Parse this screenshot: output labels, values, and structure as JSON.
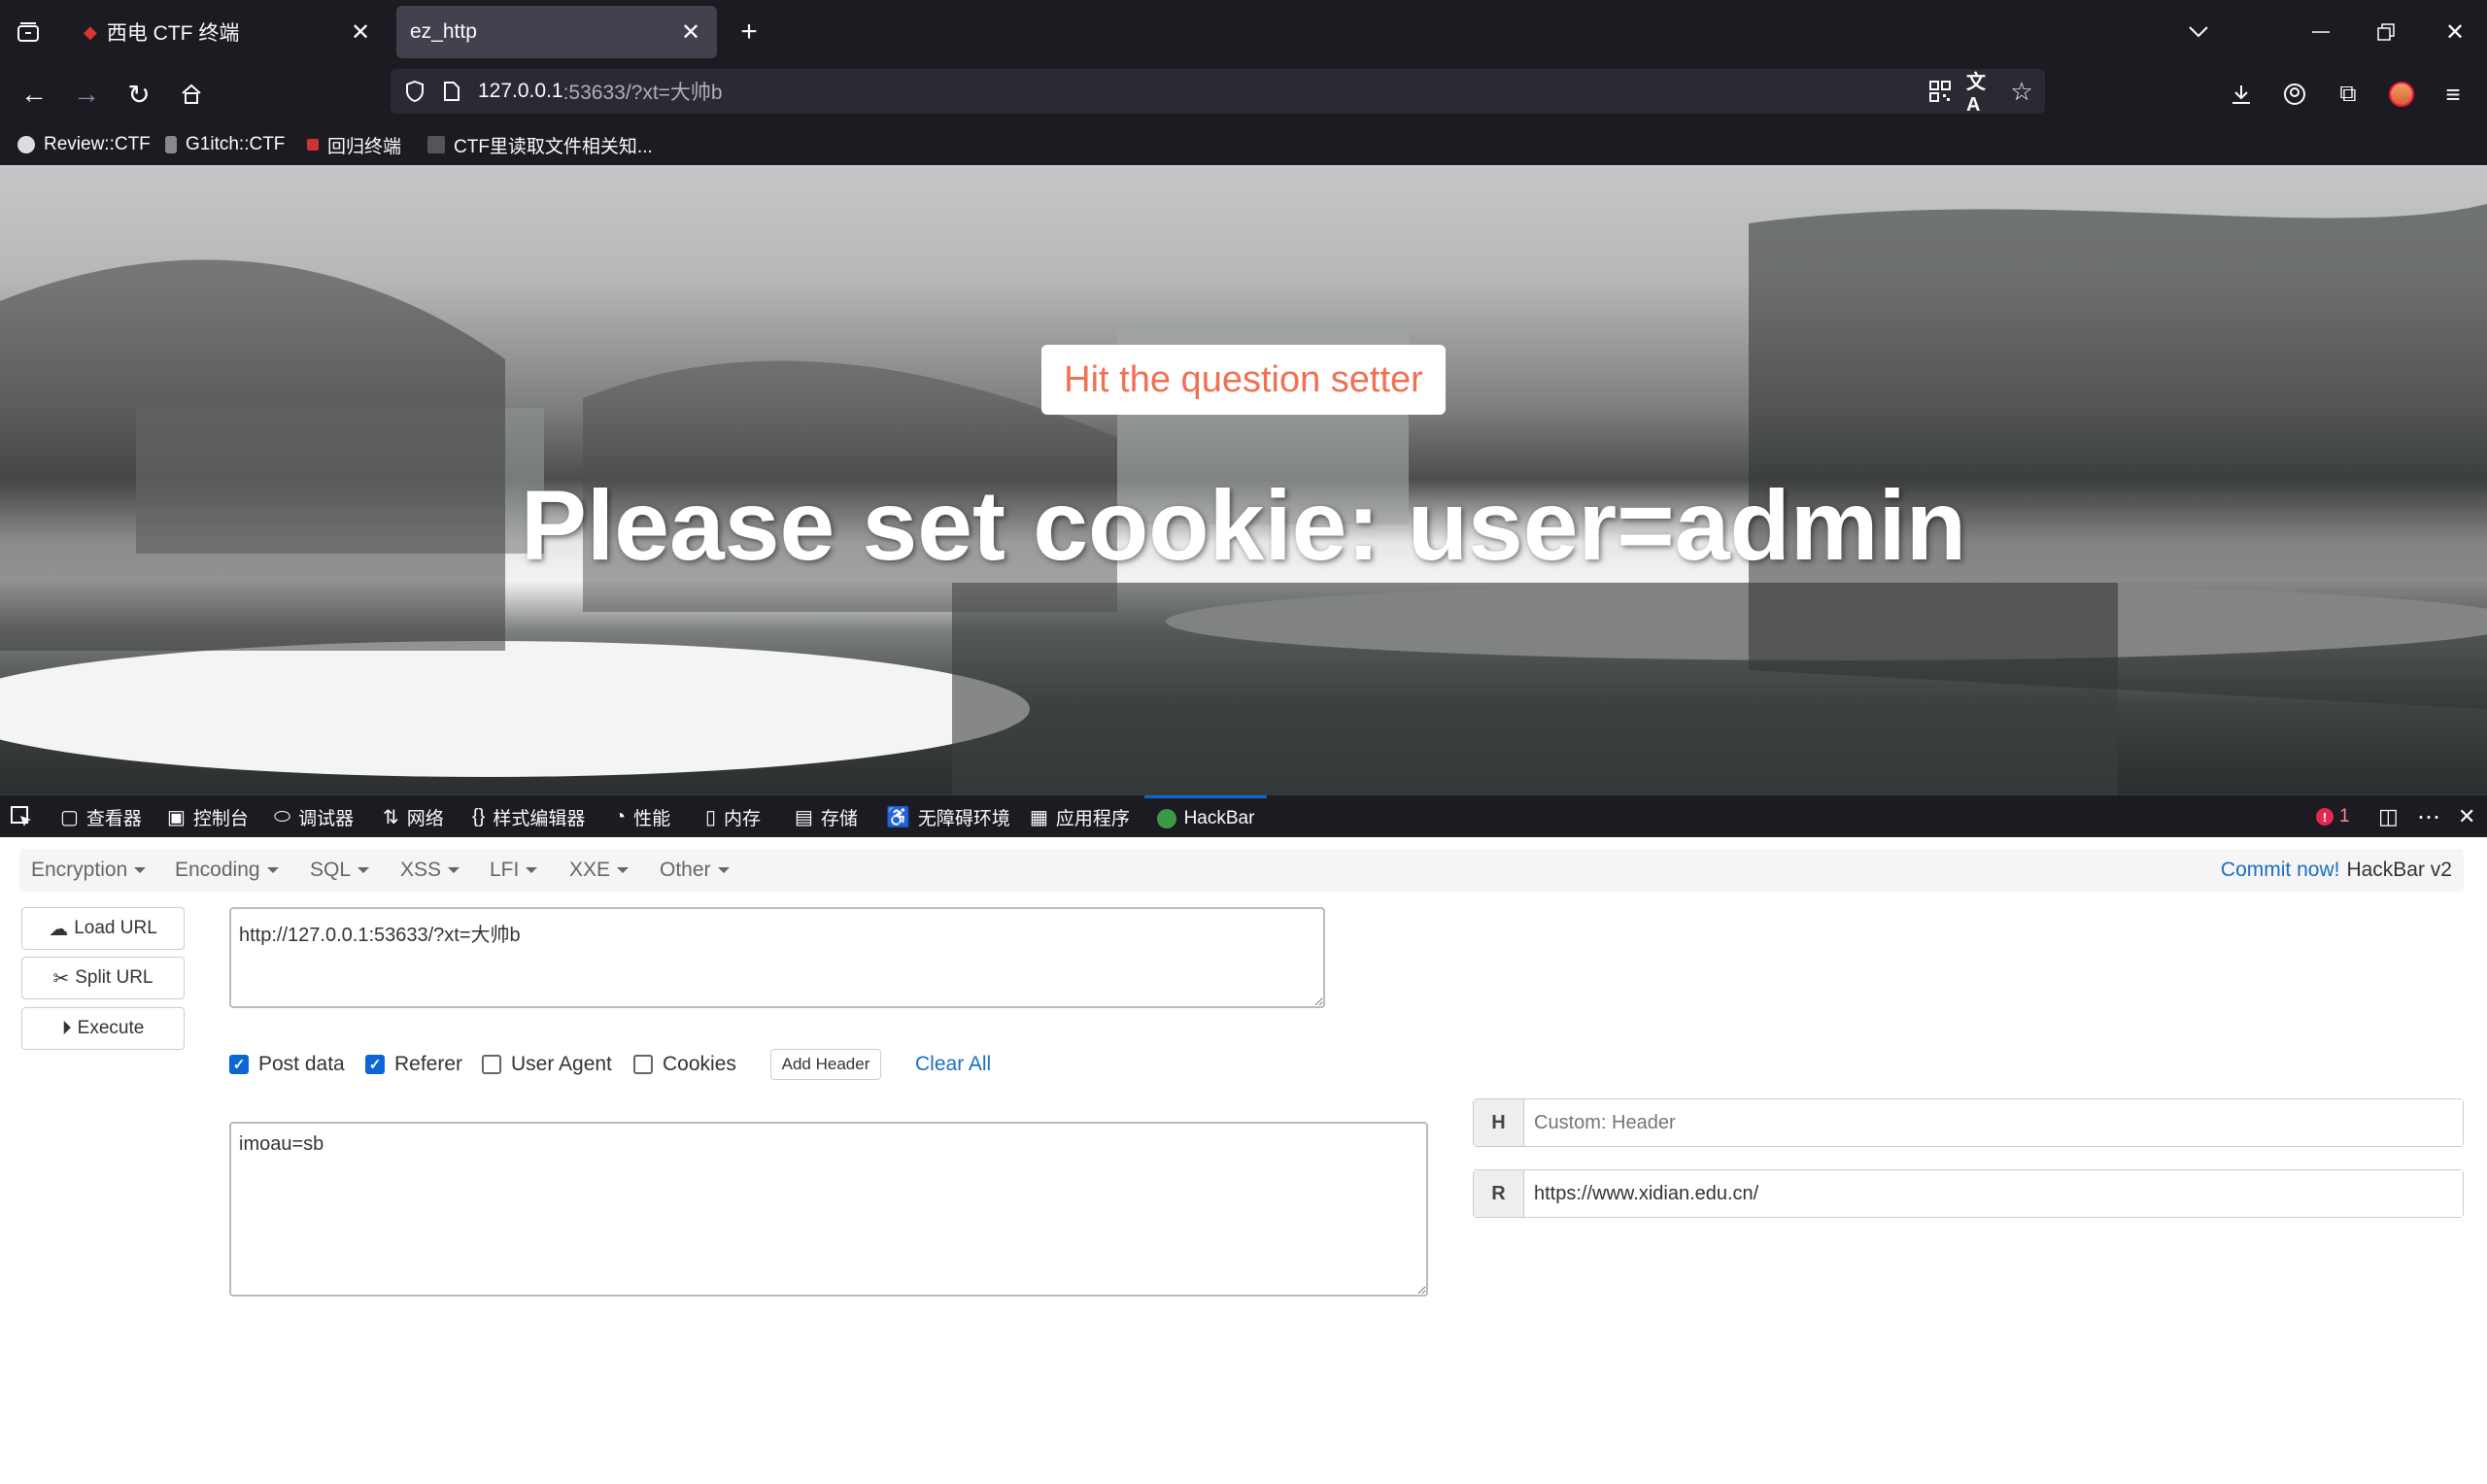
{
  "browser": {
    "tabs": [
      {
        "title": "西电 CTF 终端",
        "active": false
      },
      {
        "title": "ez_http",
        "active": true
      }
    ],
    "url": {
      "host": "127.0.0.1",
      "rest": ":53633/?xt=大帅b"
    },
    "bookmarks": [
      "Review::CTF",
      "G1itch::CTF",
      "回归终端",
      "CTF里读取文件相关知..."
    ]
  },
  "page": {
    "button_label": "Hit the question setter",
    "headline": "Please set cookie: user=admin"
  },
  "devtools": {
    "tabs": [
      "查看器",
      "控制台",
      "调试器",
      "网络",
      "样式编辑器",
      "性能",
      "内存",
      "存储",
      "无障碍环境",
      "应用程序",
      "HackBar"
    ],
    "active_tab": "HackBar",
    "error_count": "1"
  },
  "hackbar": {
    "menu": [
      "Encryption",
      "Encoding",
      "SQL",
      "XSS",
      "LFI",
      "XXE",
      "Other"
    ],
    "commit_link": "Commit now!",
    "version": "HackBar v2",
    "buttons": {
      "load": "Load URL",
      "split": "Split URL",
      "execute": "Execute"
    },
    "url_value": "http://127.0.0.1:53633/?xt=大帅b",
    "checks": [
      {
        "label": "Post data",
        "checked": true
      },
      {
        "label": "Referer",
        "checked": true
      },
      {
        "label": "User Agent",
        "checked": false
      },
      {
        "label": "Cookies",
        "checked": false
      }
    ],
    "add_header": "Add Header",
    "clear_all": "Clear All",
    "post_body": "imoau=sb",
    "headers": [
      {
        "key": "H",
        "value": "",
        "placeholder": "Custom: Header"
      },
      {
        "key": "R",
        "value": "https://www.xidian.edu.cn/",
        "placeholder": ""
      }
    ]
  },
  "colors": {
    "accent": "#0b67d6",
    "devtools_active": "#0b67d6",
    "hero_button_text": "#f07053"
  }
}
